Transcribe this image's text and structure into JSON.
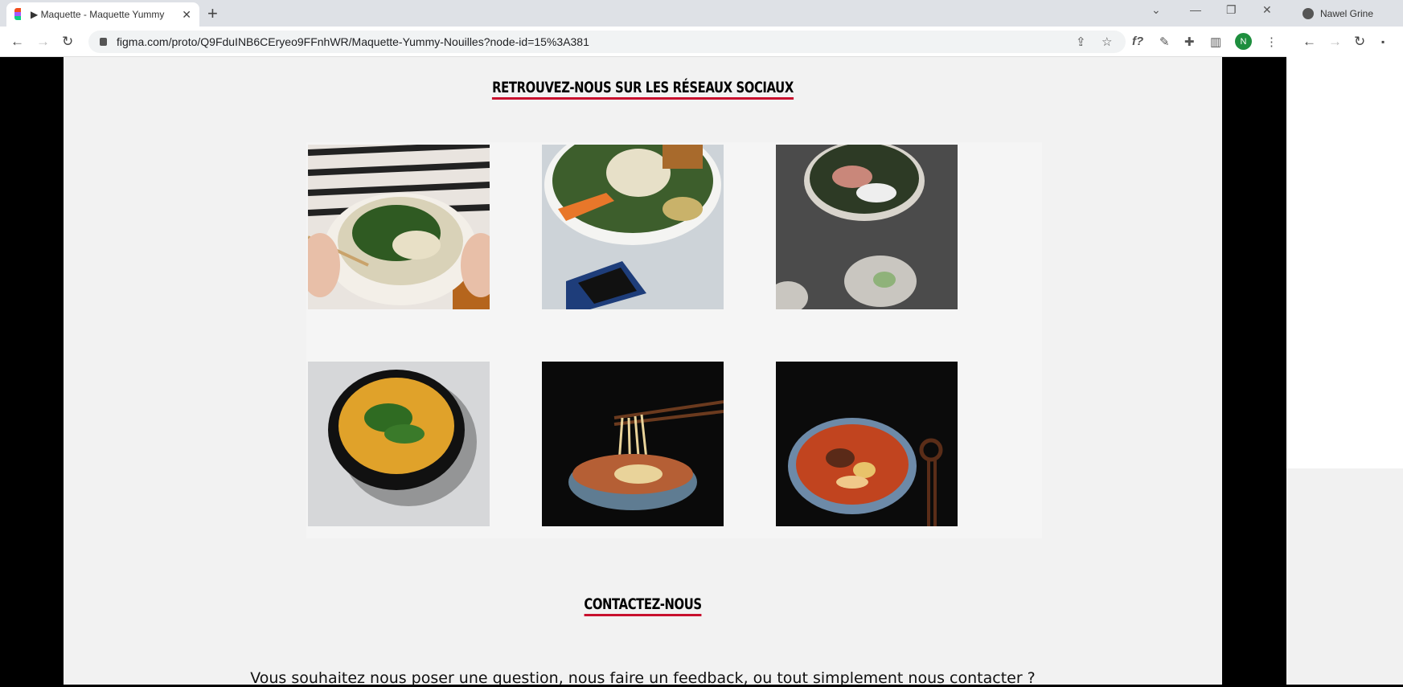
{
  "browser": {
    "tab_title": "▶ Maquette - Maquette Yummy",
    "url": "figma.com/proto/Q9FduINB6CEryeo9FFnhWR/Maquette-Yummy-Nouilles?node-id=15%3A381",
    "profile_name": "Nawel Grine",
    "avatar_initial": "N"
  },
  "page": {
    "social_title": "RETROUVEZ-NOUS SUR LES RÉSEAUX SOCIAUX",
    "contact_title": "CONTACTEZ-NOUS",
    "contact_text": "Vous souhaitez nous poser une question, nous faire un feedback, ou tout simplement nous contacter ?"
  },
  "colors": {
    "accent_underline": "#c8102e",
    "page_bg": "#f2f2f2"
  }
}
